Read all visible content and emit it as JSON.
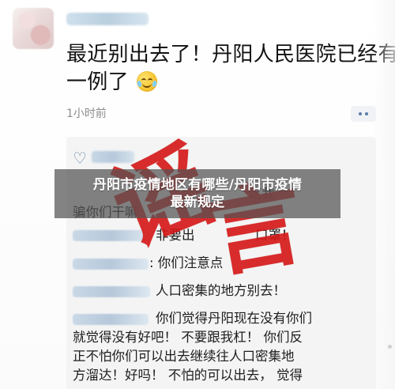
{
  "post": {
    "text_line_1": "最近别出去了！丹阳人民医院已经有",
    "text_line_2_prefix": "一例了",
    "time": "1小时前"
  },
  "overlay": {
    "stamp_text_1": "谣",
    "stamp_text_2": "言",
    "title_line_1": "丹阳市疫情地区有哪些/丹阳市疫情",
    "title_line_2": "最新规定"
  },
  "comments": [
    {
      "text_parts": [
        "这我",
        "骗你们干嘛"
      ]
    },
    {
      "text": "非要出"
    },
    {
      "text": "口罩！"
    },
    {
      "text": ": 你们注意点"
    },
    {
      "text": "人口密集的地方别去！"
    },
    {
      "text_lines": [
        "你们觉得丹阳现在没有你们",
        "就觉得没有好吧！ 不要跟我杠！ 你们反",
        "正不怕你们可以出去继续往人口密集地",
        "方溜达！好吗！ 不怕的可以出去， 觉得"
      ]
    }
  ],
  "colors": {
    "stamp_red": "#d61616",
    "banner_bg": "rgba(83,83,83,0.72)",
    "link_blue": "#6884a7"
  },
  "icons": {
    "like": "heart-outline-icon",
    "more": "more-dots-icon",
    "emoji": "laughing-crying-emoji-icon"
  }
}
